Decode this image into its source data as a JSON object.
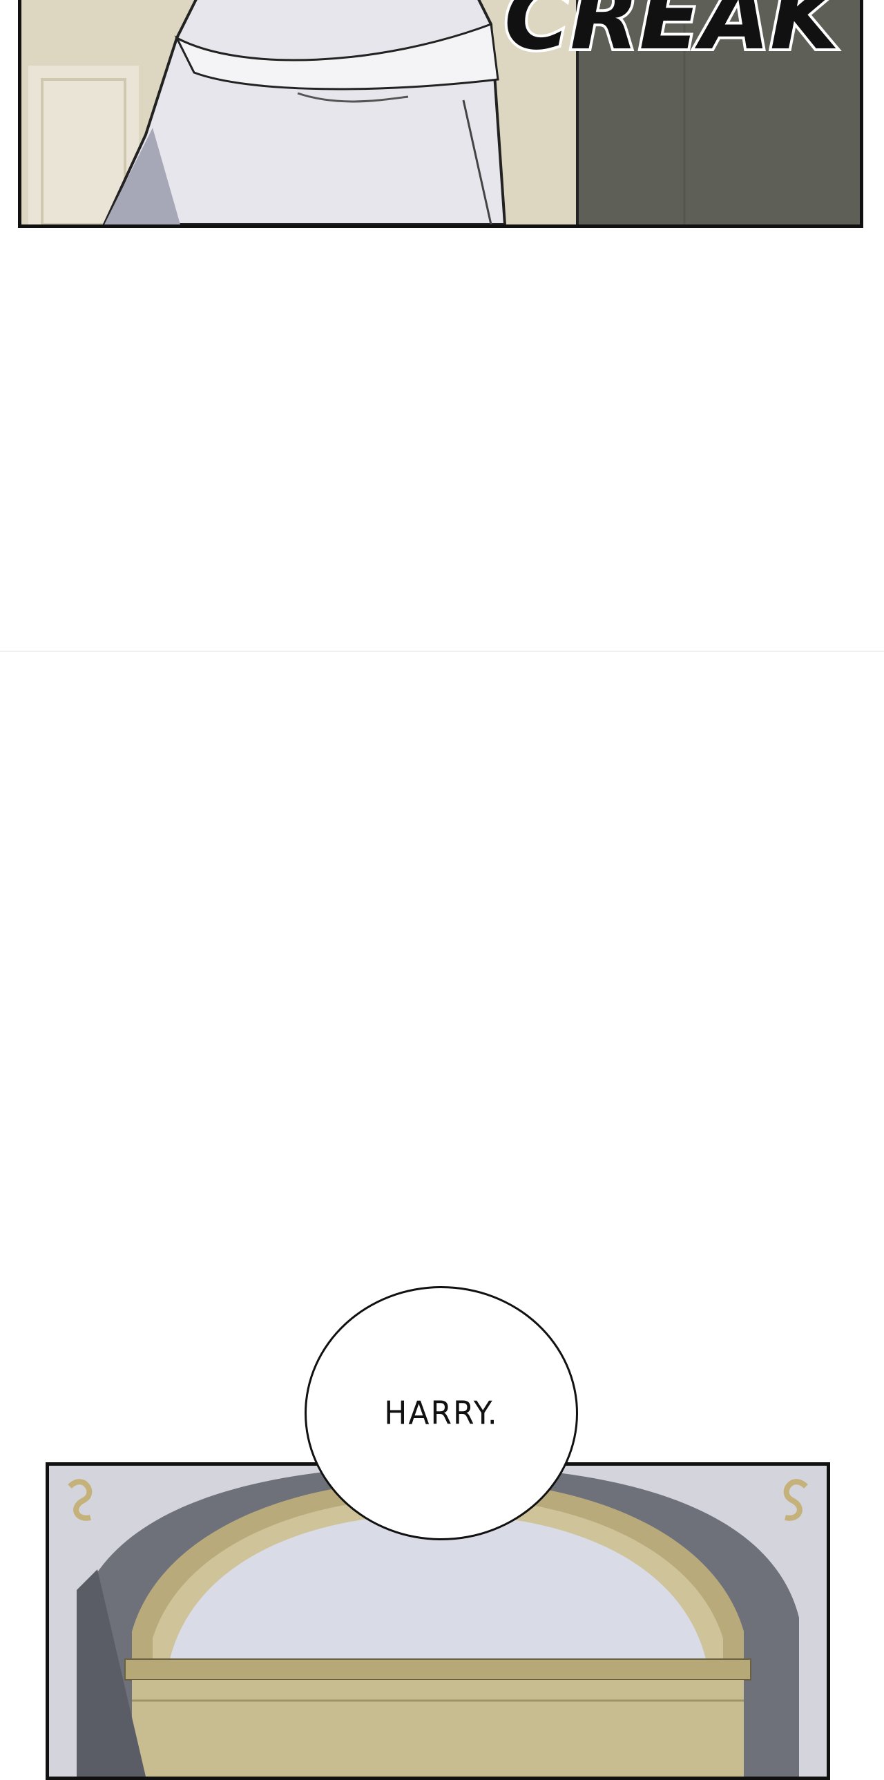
{
  "panels": [
    {
      "name": "top-panel",
      "scene": "white-robed-figure-and-door"
    },
    {
      "name": "bottom-panel",
      "scene": "arched-doorway-interior"
    }
  ],
  "sound_effect": {
    "text": "CREAK"
  },
  "speech_bubble": {
    "text": "HARRY."
  },
  "colors": {
    "page_background": "#ffffff",
    "panel_border": "#111111",
    "wall": "#d9d2bc",
    "door_gray": "#5e6058",
    "robe": "#e4e4ea",
    "arch_stone": "#6d7079",
    "arch_gold": "#b8aa7a",
    "window_light": "#d7d9e4"
  }
}
